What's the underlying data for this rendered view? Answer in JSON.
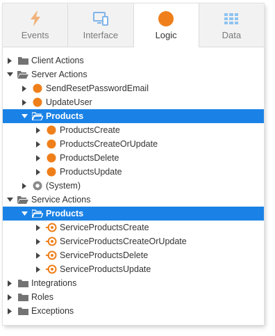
{
  "tabs": [
    {
      "label": "Events",
      "icon": "lightning-icon"
    },
    {
      "label": "Interface",
      "icon": "monitor-icon"
    },
    {
      "label": "Logic",
      "icon": "logic-circle-icon"
    },
    {
      "label": "Data",
      "icon": "grid-table-icon"
    }
  ],
  "active_tab": "Logic",
  "colors": {
    "accent": "#1a82e6",
    "logic": "#ef7f1a",
    "folder": "#737373"
  },
  "tree": {
    "client_actions": "Client Actions",
    "server_actions": "Server Actions",
    "send_reset_password_email": "SendResetPasswordEmail",
    "update_user": "UpdateUser",
    "products_folder": "Products",
    "products_create": "ProductsCreate",
    "products_create_or_update": "ProductsCreateOrUpdate",
    "products_delete": "ProductsDelete",
    "products_update": "ProductsUpdate",
    "system": "(System)",
    "service_actions": "Service Actions",
    "service_products_folder": "Products",
    "service_products_create": "ServiceProductsCreate",
    "service_products_create_or_update": "ServiceProductsCreateOrUpdate",
    "service_products_delete": "ServiceProductsDelete",
    "service_products_update": "ServiceProductsUpdate",
    "integrations": "Integrations",
    "roles": "Roles",
    "exceptions": "Exceptions"
  }
}
